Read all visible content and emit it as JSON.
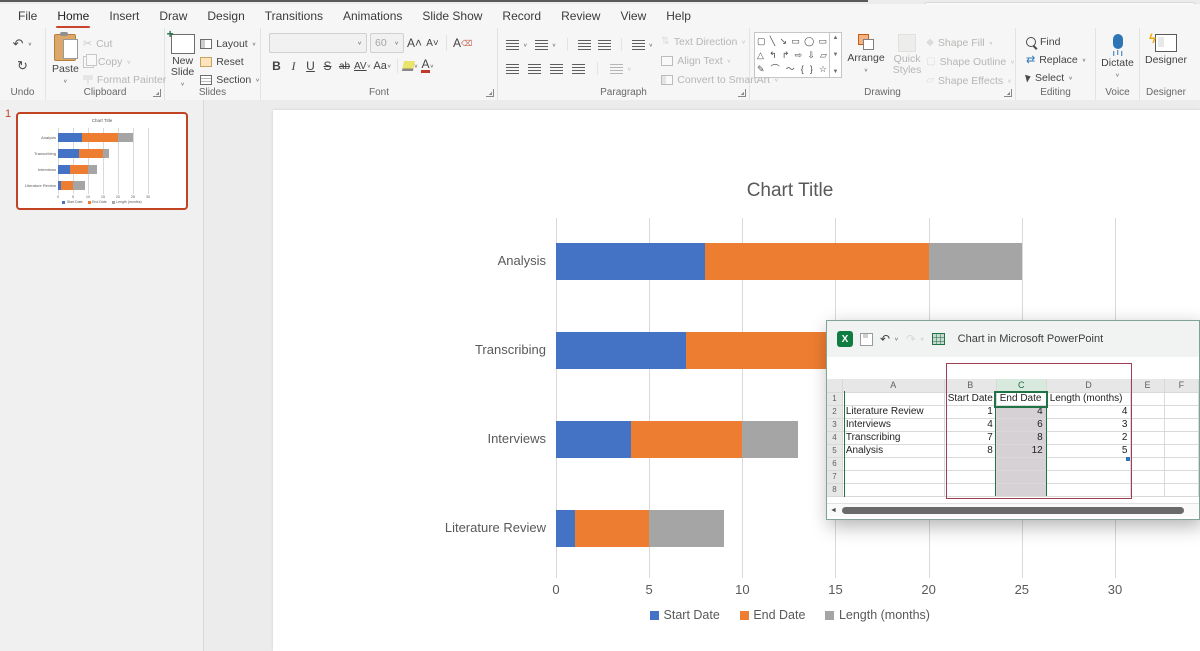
{
  "menu": {
    "items": [
      "File",
      "Home",
      "Insert",
      "Draw",
      "Design",
      "Transitions",
      "Animations",
      "Slide Show",
      "Record",
      "Review",
      "View",
      "Help"
    ],
    "active": "Home"
  },
  "ribbon": {
    "groups": {
      "undo": "Undo",
      "clipboard": "Clipboard",
      "slides": "Slides",
      "font": "Font",
      "paragraph": "Paragraph",
      "drawing": "Drawing",
      "editing": "Editing",
      "voice": "Voice",
      "designer": "Designer"
    },
    "clipboard": {
      "paste": "Paste",
      "cut": "Cut",
      "copy": "Copy",
      "format_painter": "Format Painter"
    },
    "slides": {
      "new_slide": "New Slide",
      "layout": "Layout",
      "reset": "Reset",
      "section": "Section"
    },
    "font": {
      "size": "60",
      "bold": "B",
      "italic": "I",
      "underline": "U",
      "strike": "S",
      "strike_ab": "ab",
      "spacing": "AV",
      "case": "Aa",
      "color": "A",
      "grow": "A˄",
      "shrink": "A˅",
      "clear": "A⌫"
    },
    "paragraph": {
      "text_direction": "Text Direction",
      "align_text": "Align Text",
      "smartart": "Convert to SmartArt"
    },
    "drawing": {
      "arrange": "Arrange",
      "quick_styles": "Quick Styles",
      "shape_fill": "Shape Fill",
      "shape_outline": "Shape Outline",
      "shape_effects": "Shape Effects",
      "shapes_rows": [
        [
          "▢",
          "╲",
          "↘",
          "▭",
          "◯",
          "▭"
        ],
        [
          "△",
          "↰",
          "↱",
          "⇨",
          "⇩",
          "▱"
        ],
        [
          "✎",
          "⌒",
          "〜",
          "{",
          "}",
          "☆"
        ]
      ]
    },
    "editing": {
      "find": "Find",
      "replace": "Replace",
      "select": "Select"
    },
    "voice": {
      "dictate": "Dictate"
    },
    "designer": {
      "designer": "Designer"
    }
  },
  "thumbnail": {
    "number": "1"
  },
  "chart_data": {
    "type": "bar",
    "orientation": "horizontal",
    "stacked": true,
    "title": "Chart Title",
    "categories": [
      "Literature Review",
      "Interviews",
      "Transcribing",
      "Analysis"
    ],
    "display_order_top_to_bottom": [
      "Analysis",
      "Transcribing",
      "Interviews",
      "Literature Review"
    ],
    "series": [
      {
        "name": "Start Date",
        "color": "#4472C4",
        "values": [
          1,
          4,
          7,
          8
        ]
      },
      {
        "name": "End Date",
        "color": "#ED7D31",
        "values": [
          4,
          6,
          8,
          12
        ]
      },
      {
        "name": "Length (months)",
        "color": "#A5A5A5",
        "values": [
          4,
          3,
          2,
          5
        ]
      }
    ],
    "xlim": [
      0,
      30
    ],
    "xticks": [
      0,
      5,
      10,
      15,
      20,
      25,
      30
    ],
    "grid": true,
    "legend_position": "bottom"
  },
  "excel": {
    "title": "Chart in Microsoft PowerPoint",
    "columns": [
      "A",
      "B",
      "C",
      "D",
      "E",
      "F"
    ],
    "selected_column": "C",
    "rows": [
      {
        "n": "1",
        "cells": [
          "",
          "Start Date",
          "End Date",
          "Length (months)",
          "",
          ""
        ]
      },
      {
        "n": "2",
        "cells": [
          "Literature Review",
          "1",
          "4",
          "4",
          "",
          ""
        ]
      },
      {
        "n": "3",
        "cells": [
          "Interviews",
          "4",
          "6",
          "3",
          "",
          ""
        ]
      },
      {
        "n": "4",
        "cells": [
          "Transcribing",
          "7",
          "8",
          "2",
          "",
          ""
        ]
      },
      {
        "n": "5",
        "cells": [
          "Analysis",
          "8",
          "12",
          "5",
          "",
          ""
        ]
      },
      {
        "n": "6",
        "cells": [
          "",
          "",
          "",
          "",
          "",
          ""
        ]
      },
      {
        "n": "7",
        "cells": [
          "",
          "",
          "",
          "",
          "",
          ""
        ]
      },
      {
        "n": "8",
        "cells": [
          "",
          "",
          "",
          "",
          "",
          ""
        ]
      }
    ]
  },
  "colors": {
    "accent_blue": "#4472C4",
    "accent_orange": "#ED7D31",
    "accent_gray": "#A5A5A5",
    "home_underline": "#C8442B",
    "thumbnail_border": "#C04323",
    "excel_green": "#217346",
    "range_box": "#9E3D53",
    "chart_text": "#595959"
  }
}
